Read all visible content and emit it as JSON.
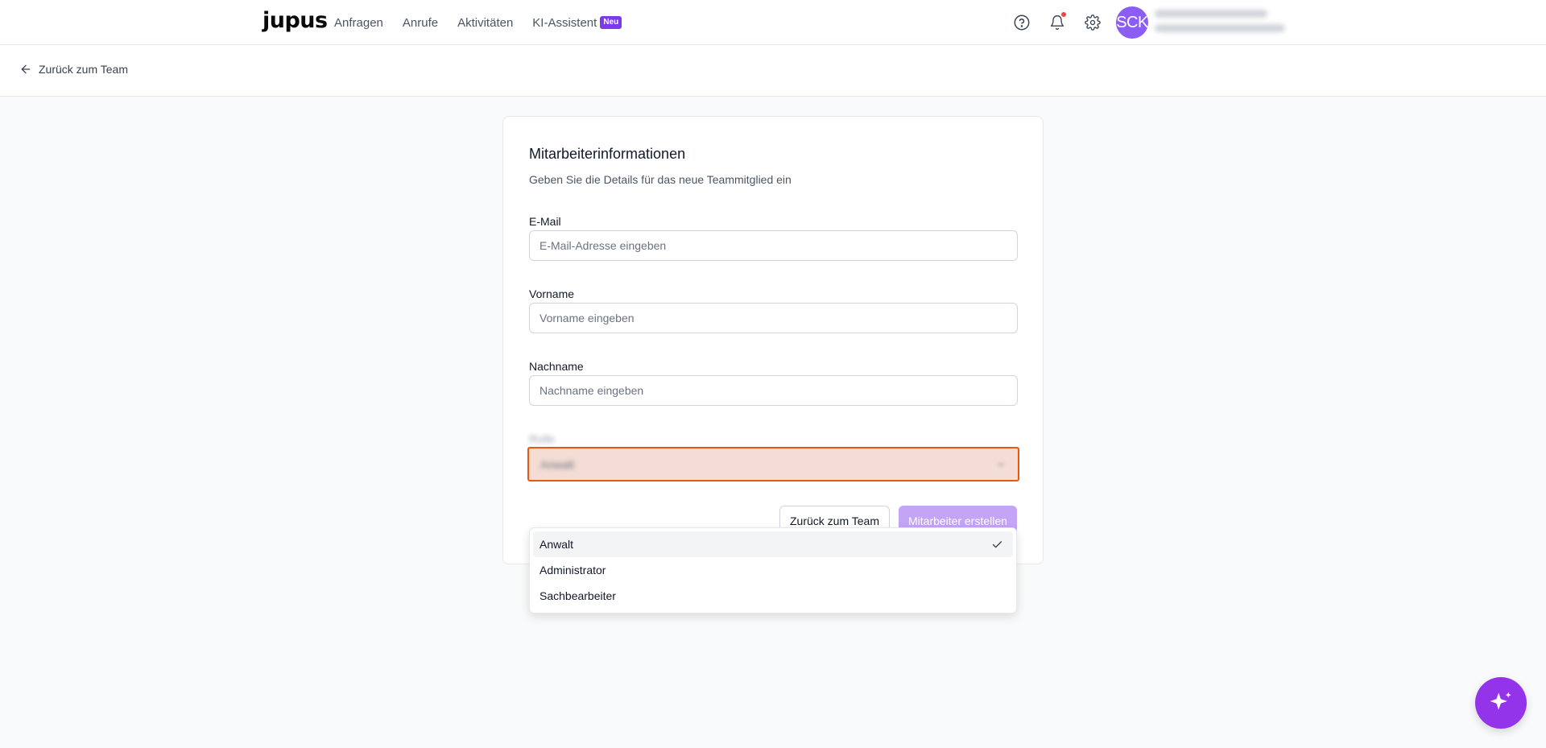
{
  "nav": {
    "logo": "jupus",
    "links": [
      "Anfragen",
      "Anrufe",
      "Aktivitäten",
      "KI-Assistent"
    ],
    "badge": "Neu",
    "avatar_initials": "SCK",
    "notification_dot_color": "#ef4444",
    "icons": [
      "help-icon",
      "bell-icon",
      "settings-icon"
    ]
  },
  "subheader": {
    "back_label": "Zurück zum Team"
  },
  "form": {
    "title": "Mitarbeiterinformationen",
    "subtitle": "Geben Sie die Details für das neue Teammitglied ein",
    "email": {
      "label": "E-Mail",
      "placeholder": "E-Mail-Adresse eingeben",
      "value": ""
    },
    "firstname": {
      "label": "Vorname",
      "placeholder": "Vorname eingeben",
      "value": ""
    },
    "lastname": {
      "label": "Nachname",
      "placeholder": "Nachname eingeben",
      "value": ""
    },
    "role": {
      "label": "Rolle",
      "value": "Anwalt"
    },
    "back_button": "Zurück zum Team",
    "submit_button": "Mitarbeiter erstellen"
  },
  "dropdown": {
    "options": [
      "Anwalt",
      "Administrator",
      "Sachbearbeiter"
    ],
    "selected": "Anwalt"
  },
  "colors": {
    "accent": "#7c3aed",
    "avatar": "#8b5cf6",
    "fab": "#9333ea",
    "focus_border": "#ea580c",
    "primary_disabled": "#c4a4f4"
  },
  "fab_icon": "sparkle-icon"
}
